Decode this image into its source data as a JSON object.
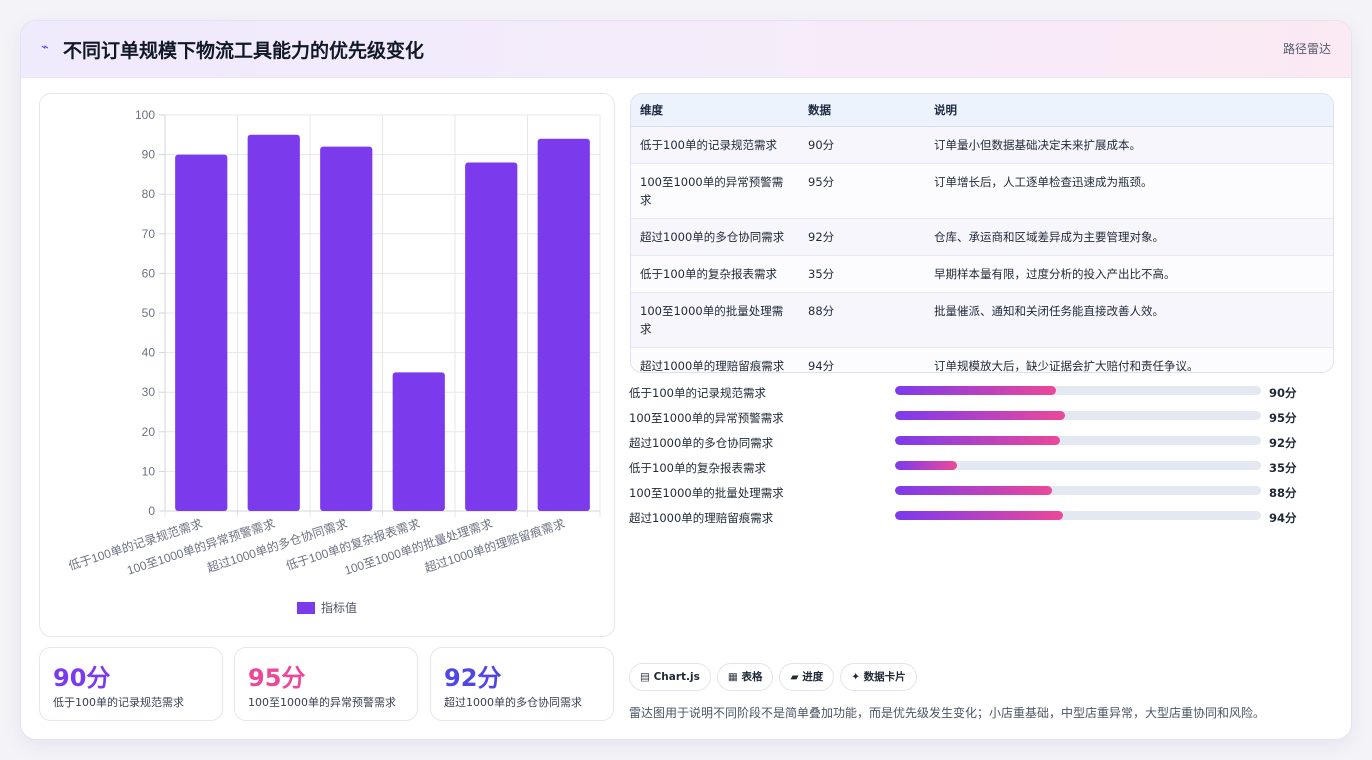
{
  "header": {
    "icon": "⌁",
    "title": "不同订单规模下物流工具能力的优先级变化",
    "tag": "路径雷达"
  },
  "chart_data": {
    "type": "bar",
    "categories": [
      "低于100单的记录规范需求",
      "100至1000单的异常预警需求",
      "超过1000单的多仓协同需求",
      "低于100单的复杂报表需求",
      "100至1000单的批量处理需求",
      "超过1000单的理赔留痕需求"
    ],
    "series": [
      {
        "name": "指标值",
        "values": [
          90,
          95,
          92,
          35,
          88,
          94
        ],
        "color": "#7c3aed"
      }
    ],
    "ylim": [
      0,
      100
    ],
    "yticks": [
      0,
      10,
      20,
      30,
      40,
      50,
      60,
      70,
      80,
      90,
      100
    ],
    "grid": true,
    "legend": "bottom"
  },
  "stats": [
    {
      "value": "90分",
      "label": "低于100单的记录规范需求",
      "color": "#7c3aed"
    },
    {
      "value": "95分",
      "label": "100至1000单的异常预警需求",
      "color": "#ec4899"
    },
    {
      "value": "92分",
      "label": "超过1000单的多仓协同需求",
      "color": "#4f46e5"
    }
  ],
  "table": {
    "headers": [
      "维度",
      "数据",
      "说明"
    ],
    "rows": [
      [
        "低于100单的记录规范需求",
        "90分",
        "订单量小但数据基础决定未来扩展成本。"
      ],
      [
        "100至1000单的异常预警需求",
        "95分",
        "订单增长后，人工逐单检查迅速成为瓶颈。"
      ],
      [
        "超过1000单的多仓协同需求",
        "92分",
        "仓库、承运商和区域差异成为主要管理对象。"
      ],
      [
        "低于100单的复杂报表需求",
        "35分",
        "早期样本量有限，过度分析的投入产出比不高。"
      ],
      [
        "100至1000单的批量处理需求",
        "88分",
        "批量催派、通知和关闭任务能直接改善人效。"
      ],
      [
        "超过1000单的理赔留痕需求",
        "94分",
        "订单规模放大后，缺少证据会扩大赔付和责任争议。"
      ]
    ]
  },
  "progress": [
    {
      "label": "低于100单的记录规范需求",
      "value": "90分",
      "fraction": 0.44
    },
    {
      "label": "100至1000单的异常预警需求",
      "value": "95分",
      "fraction": 0.465
    },
    {
      "label": "超过1000单的多仓协同需求",
      "value": "92分",
      "fraction": 0.45
    },
    {
      "label": "低于100单的复杂报表需求",
      "value": "35分",
      "fraction": 0.17
    },
    {
      "label": "100至1000单的批量处理需求",
      "value": "88分",
      "fraction": 0.43
    },
    {
      "label": "超过1000单的理赔留痕需求",
      "value": "94分",
      "fraction": 0.46
    }
  ],
  "chips": [
    "▤ Chart.js",
    "▦ 表格",
    "▰ 进度",
    "✦ 数据卡片"
  ],
  "note": "雷达图用于说明不同阶段不是简单叠加功能，而是优先级发生变化；小店重基础，中型店重异常，大型店重协同和风险。"
}
